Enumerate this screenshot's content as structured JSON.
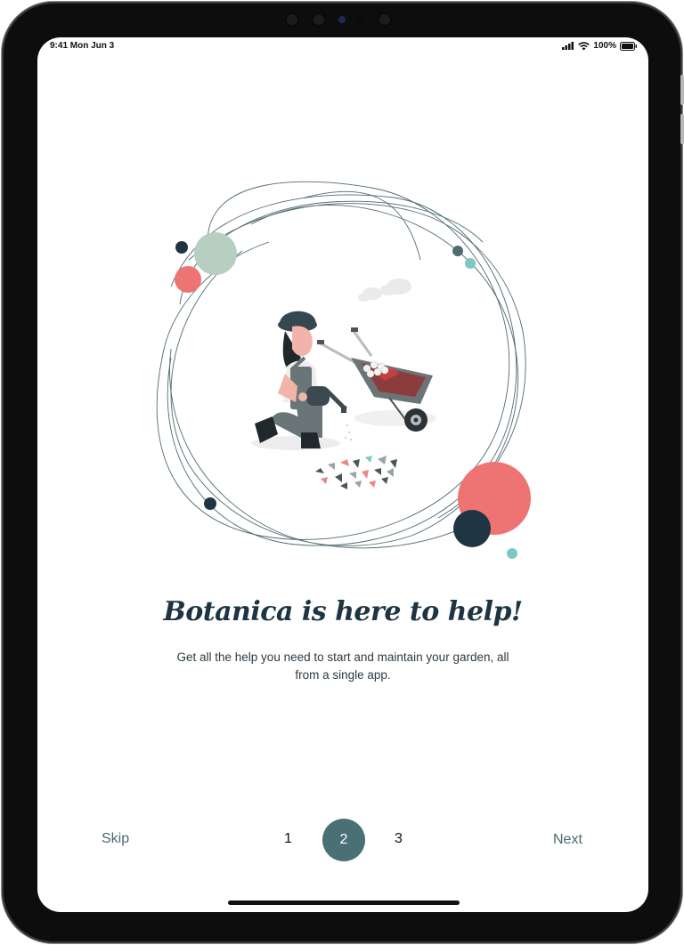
{
  "status_bar": {
    "time": "9:41",
    "date": "Mon Jun 3",
    "battery": "100%",
    "signal_icon": "cellular-signal-icon",
    "wifi_icon": "wifi-icon",
    "battery_icon": "battery-icon"
  },
  "onboarding": {
    "title": "Botanica is here to help!",
    "subtitle": "Get all the help you need to start and maintain your garden, all from a single app.",
    "illustration": "gardener-with-watering-can-and-wheelbarrow"
  },
  "navigation": {
    "skip_label": "Skip",
    "next_label": "Next",
    "pages": [
      "1",
      "2",
      "3"
    ],
    "current_page": "2"
  },
  "colors": {
    "primary": "#4a7075",
    "title": "#1d3543",
    "coral": "#ee7474",
    "sage": "#b7cfc0",
    "navy": "#1f3543",
    "teal": "#7ec7c4"
  }
}
